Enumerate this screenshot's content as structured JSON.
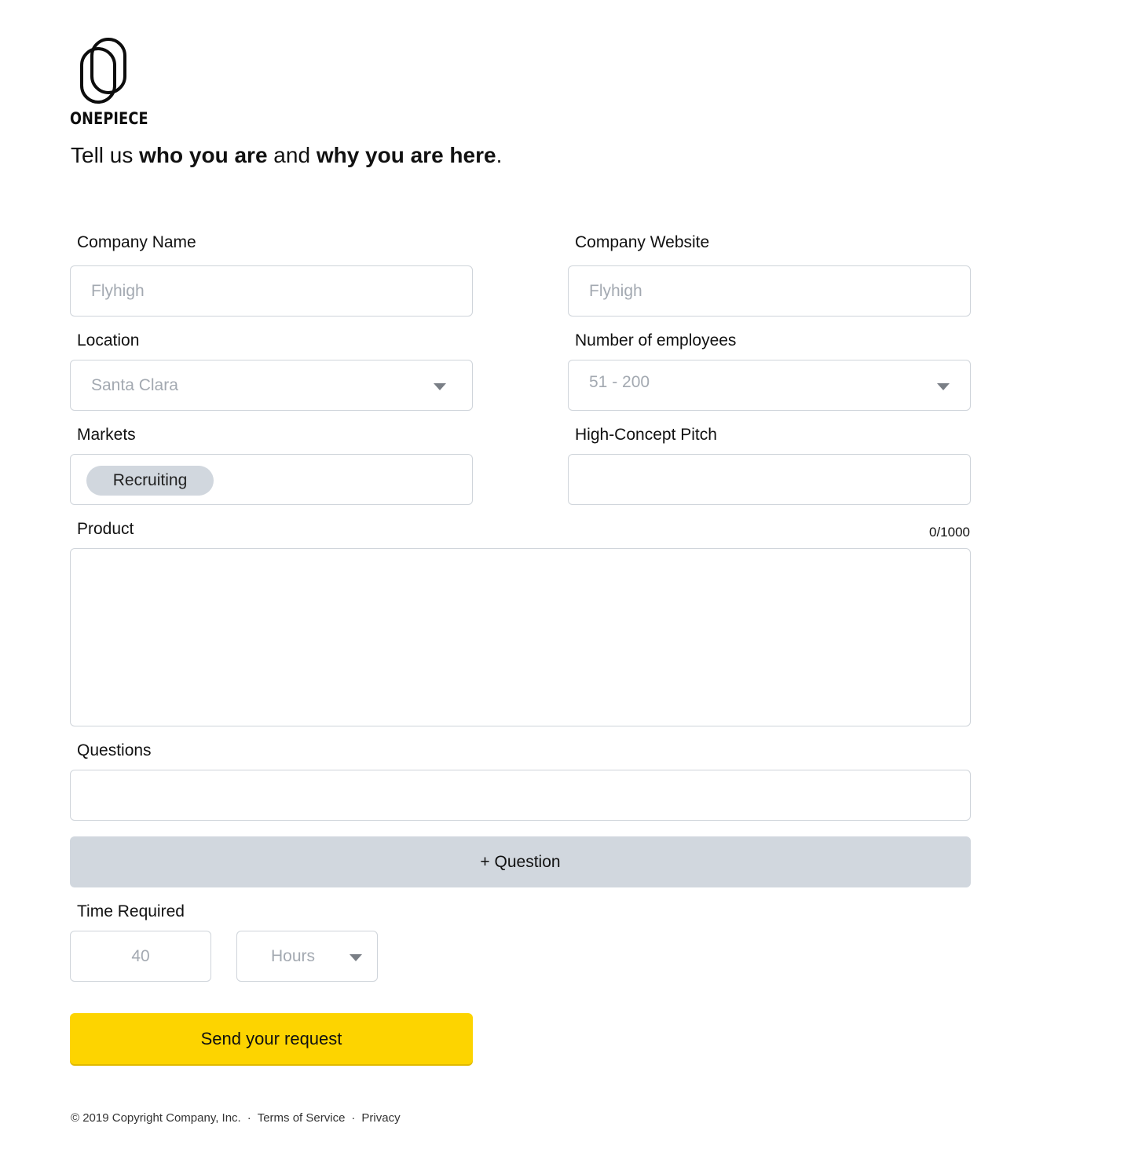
{
  "brand": {
    "name": "ONEPIECE",
    "logo_icon": "paperclip-icon"
  },
  "headline": {
    "part1": "Tell us ",
    "bold1": "who you are",
    "part2": " and ",
    "bold2": "why you are here",
    "part3": "."
  },
  "form": {
    "company_name": {
      "label": "Company Name",
      "placeholder": "Flyhigh"
    },
    "company_website": {
      "label": "Company Website",
      "placeholder": "Flyhigh"
    },
    "location": {
      "label": "Location",
      "value": "Santa Clara",
      "icon": "chevron-down-icon"
    },
    "employees": {
      "label": "Number of employees",
      "value": "51 - 200",
      "icon": "chevron-down-icon"
    },
    "markets": {
      "label": "Markets",
      "chips": [
        "Recruiting"
      ]
    },
    "pitch": {
      "label": "High-Concept Pitch",
      "value": ""
    },
    "product": {
      "label": "Product",
      "counter": "0/1000",
      "value": ""
    },
    "questions": {
      "label": "Questions",
      "value": "",
      "add_label": "+ Question"
    },
    "time_required": {
      "label": "Time Required",
      "amount": "40",
      "unit": "Hours",
      "icon": "chevron-down-icon"
    },
    "submit_label": "Send your request"
  },
  "footer": {
    "copyright": "© 2019 Copyright Company, Inc.",
    "separator": "·",
    "terms": "Terms of Service",
    "privacy": "Privacy"
  },
  "colors": {
    "accent": "#fdd400",
    "chip_bg": "#d1d7de",
    "border": "#cfd4da",
    "placeholder": "#a3a9b1"
  }
}
